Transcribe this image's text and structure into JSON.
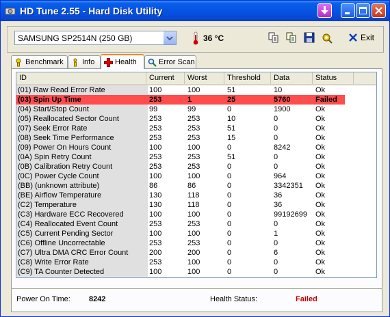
{
  "window": {
    "title": "HD Tune 2.55 - Hard Disk Utility"
  },
  "toolbar": {
    "drive": "SAMSUNG SP2514N (250 GB)",
    "temperature": "36 °C",
    "exit_label": "Exit"
  },
  "tabs": [
    {
      "label": "Benchmark",
      "active": false
    },
    {
      "label": "Info",
      "active": false
    },
    {
      "label": "Health",
      "active": true
    },
    {
      "label": "Error Scan",
      "active": false
    }
  ],
  "table": {
    "headers": [
      "ID",
      "Current",
      "Worst",
      "Threshold",
      "Data",
      "Status"
    ],
    "rows": [
      {
        "id": "(01) Raw Read Error Rate",
        "current": "100",
        "worst": "100",
        "threshold": "51",
        "data": "10",
        "status": "Ok"
      },
      {
        "id": "(03) Spin Up Time",
        "current": "253",
        "worst": "1",
        "threshold": "25",
        "data": "5760",
        "status": "Failed",
        "failed": true
      },
      {
        "id": "(04) Start/Stop Count",
        "current": "99",
        "worst": "99",
        "threshold": "0",
        "data": "1900",
        "status": "Ok"
      },
      {
        "id": "(05) Reallocated Sector Count",
        "current": "253",
        "worst": "253",
        "threshold": "10",
        "data": "0",
        "status": "Ok"
      },
      {
        "id": "(07) Seek Error Rate",
        "current": "253",
        "worst": "253",
        "threshold": "51",
        "data": "0",
        "status": "Ok"
      },
      {
        "id": "(08) Seek Time Performance",
        "current": "253",
        "worst": "253",
        "threshold": "15",
        "data": "0",
        "status": "Ok"
      },
      {
        "id": "(09) Power On Hours Count",
        "current": "100",
        "worst": "100",
        "threshold": "0",
        "data": "8242",
        "status": "Ok"
      },
      {
        "id": "(0A) Spin Retry Count",
        "current": "253",
        "worst": "253",
        "threshold": "51",
        "data": "0",
        "status": "Ok"
      },
      {
        "id": "(0B) Calibration Retry Count",
        "current": "253",
        "worst": "253",
        "threshold": "0",
        "data": "0",
        "status": "Ok"
      },
      {
        "id": "(0C) Power Cycle Count",
        "current": "100",
        "worst": "100",
        "threshold": "0",
        "data": "964",
        "status": "Ok"
      },
      {
        "id": "(BB) (unknown attribute)",
        "current": "86",
        "worst": "86",
        "threshold": "0",
        "data": "3342351",
        "status": "Ok"
      },
      {
        "id": "(BE) Airflow Temperature",
        "current": "130",
        "worst": "118",
        "threshold": "0",
        "data": "36",
        "status": "Ok"
      },
      {
        "id": "(C2) Temperature",
        "current": "130",
        "worst": "118",
        "threshold": "0",
        "data": "36",
        "status": "Ok"
      },
      {
        "id": "(C3) Hardware ECC Recovered",
        "current": "100",
        "worst": "100",
        "threshold": "0",
        "data": "99192699",
        "status": "Ok"
      },
      {
        "id": "(C4) Reallocated Event Count",
        "current": "253",
        "worst": "253",
        "threshold": "0",
        "data": "0",
        "status": "Ok"
      },
      {
        "id": "(C5) Current Pending Sector",
        "current": "100",
        "worst": "100",
        "threshold": "0",
        "data": "1",
        "status": "Ok"
      },
      {
        "id": "(C6) Offline Uncorrectable",
        "current": "253",
        "worst": "253",
        "threshold": "0",
        "data": "0",
        "status": "Ok"
      },
      {
        "id": "(C7) Ultra DMA CRC Error Count",
        "current": "200",
        "worst": "200",
        "threshold": "0",
        "data": "6",
        "status": "Ok"
      },
      {
        "id": "(C8) Write Error Rate",
        "current": "253",
        "worst": "100",
        "threshold": "0",
        "data": "0",
        "status": "Ok"
      },
      {
        "id": "(C9) TA Counter Detected",
        "current": "100",
        "worst": "100",
        "threshold": "0",
        "data": "0",
        "status": "Ok"
      }
    ]
  },
  "footer": {
    "power_on_label": "Power On Time:",
    "power_on_value": "8242",
    "health_label": "Health Status:",
    "health_value": "Failed",
    "health_color": "#c00000"
  },
  "icons": [
    "hdtune-app-icon",
    "minimize-to-tray-icon",
    "minimize-icon",
    "maximize-icon",
    "close-icon",
    "dropdown-arrow-icon",
    "thermometer-icon",
    "copy-icon",
    "copy-all-icon",
    "save-icon",
    "options-icon",
    "exit-icon",
    "benchmark-icon",
    "info-icon",
    "health-icon",
    "error-scan-icon"
  ]
}
